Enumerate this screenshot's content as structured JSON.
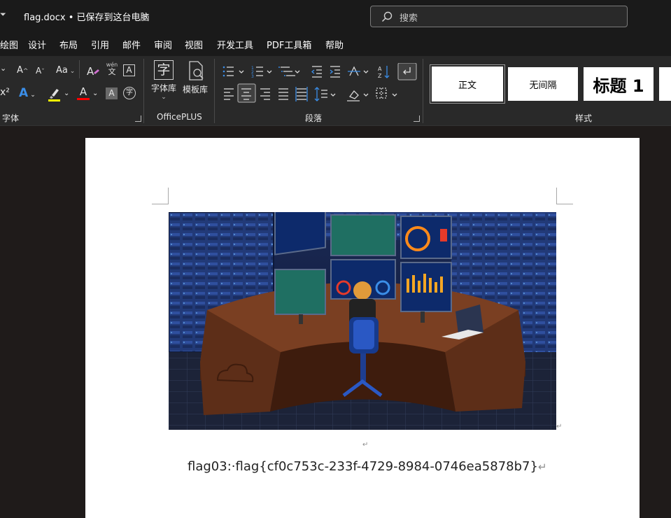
{
  "titlebar": {
    "doc_name": "flag.docx",
    "separator": "•",
    "save_status": "已保存到这台电脑",
    "search_placeholder": "搜索"
  },
  "tabs": [
    "绘图",
    "设计",
    "布局",
    "引用",
    "邮件",
    "审阅",
    "视图",
    "开发工具",
    "PDF工具箱",
    "帮助"
  ],
  "ribbon": {
    "font_group_label": "字体",
    "font_size_grow": "A",
    "font_size_shrink": "A",
    "change_case": "Aa",
    "phonetic_top": "wén",
    "phonetic_bottom": "文",
    "char_border": "A",
    "superscript": "x²",
    "text_effects": "A",
    "font_color": "A",
    "char_shading": "A",
    "enclose_char": "字",
    "officeplus_label": "OfficePLUS",
    "font_library": "字体库",
    "font_library_glyph": "字",
    "template_library": "模板库",
    "paragraph_label": "段落",
    "styles_label": "样式",
    "style_normal": "正文",
    "style_no_spacing": "无间隔",
    "style_heading1": "标题 1"
  },
  "document": {
    "empty_mark": "↵",
    "image_mark": "↵",
    "flag_text": "flag03:·flag{cf0c753c-233f-4729-8984-0746ea5878b7}",
    "flag_mark": "↵"
  },
  "colors": {
    "title_bg": "#1a1a1a",
    "ribbon_bg": "#292929",
    "canvas_bg": "#1f1b1a",
    "highlight_yellow": "#ffff00",
    "font_color_red": "#ff0000"
  }
}
